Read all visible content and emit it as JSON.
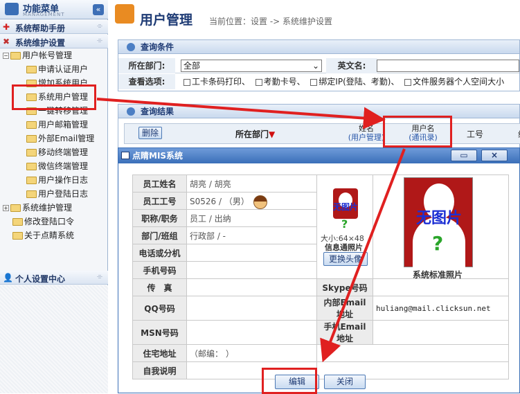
{
  "sidebar": {
    "header_title": "功能菜单",
    "header_sub": "MANAGEMENT",
    "collapse_glyph": "«",
    "help": "系统帮助手册",
    "settings": "系统维护设置",
    "tree": [
      "用户帐号管理",
      "申请认证用户",
      "增加系统用户",
      "系统用户管理",
      "一键转移管理",
      "用户邮箱管理",
      "外部Email管理",
      "移动终端管理",
      "微信终端管理",
      "用户操作日志",
      "用户登陆日志",
      "系统维护管理",
      "修改登陆口令",
      "关于点睛系统"
    ],
    "personal": "个人设置中心"
  },
  "header": {
    "title": "用户管理",
    "breadcrumb": "当前位置：设置 -> 系统维护设置"
  },
  "query": {
    "title": "查询条件",
    "dept_label": "所在部门:",
    "dept_value": "全部",
    "en_label": "英文名:",
    "opt_label": "查看选项:",
    "options": [
      "工卡条码打印、",
      "考勤卡号、",
      "绑定IP(登陆、考勤)、",
      "文件服务器个人空间大小"
    ]
  },
  "results": {
    "title": "查询结果",
    "delete": "删除",
    "col_dept": "所在部门",
    "col_name": "姓名",
    "col_name_sub": "(用户管理)",
    "col_user": "用户名",
    "col_user_sub": "(通讯录)",
    "col_id": "工号",
    "col_more": "组"
  },
  "modal": {
    "title": "点睛MIS系统",
    "fields": [
      {
        "k": "员工姓名",
        "v": "胡亮 / 胡亮"
      },
      {
        "k": "员工工号",
        "v": "S0526 / （男）"
      },
      {
        "k": "职称/职务",
        "v": "员工 / 出纳"
      },
      {
        "k": "部门/班组",
        "v": "行政部 / -"
      },
      {
        "k": "电话或分机",
        "v": ""
      },
      {
        "k": "手机号码",
        "v": ""
      },
      {
        "k": "传　真",
        "v": ""
      },
      {
        "k": "QQ号码",
        "v": ""
      },
      {
        "k": "MSN号码",
        "v": ""
      },
      {
        "k": "住宅地址",
        "v": "（邮编：  ）"
      },
      {
        "k": "自我说明",
        "v": ""
      }
    ],
    "right_fields": [
      {
        "k": "Skype号码",
        "v": ""
      },
      {
        "k": "内部Email地址",
        "v": "huliang@mail.clicksun.net"
      },
      {
        "k": "手机Email地址",
        "v": ""
      }
    ],
    "photo_text": "无图片",
    "photo_size": "大小:64×48",
    "photo_caption": "信息通照片",
    "change_avatar": "更换头像",
    "std_caption": "系统标准照片",
    "edit": "编辑",
    "close": "关闭",
    "close_glyph": "×"
  }
}
